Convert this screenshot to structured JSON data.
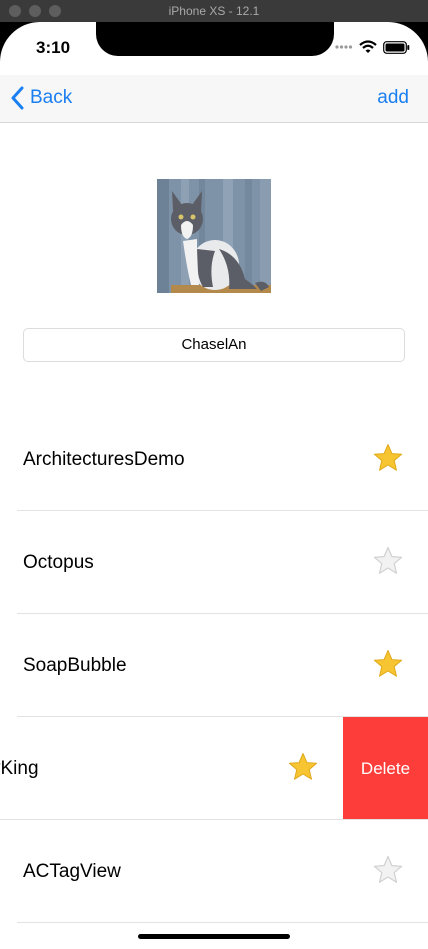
{
  "window": {
    "title": "iPhone XS - 12.1"
  },
  "status_bar": {
    "time": "3:10"
  },
  "navbar": {
    "back_label": "Back",
    "add_label": "add"
  },
  "profile": {
    "name": "ChaselAn",
    "photo_icon": "cat-photo"
  },
  "list": {
    "rows": [
      {
        "label": "ArchitecturesDemo",
        "starred": true
      },
      {
        "label": "Octopus",
        "starred": false
      },
      {
        "label": "SoapBubble",
        "starred": true
      },
      {
        "label": "yKing",
        "starred": true,
        "delete_label": "Delete"
      },
      {
        "label": "ACTagView",
        "starred": false
      }
    ]
  },
  "colors": {
    "accent": "#1a7ff0",
    "delete": "#fc3d39",
    "star_on": "#f7c531",
    "star_off": "#d9d9d9"
  }
}
